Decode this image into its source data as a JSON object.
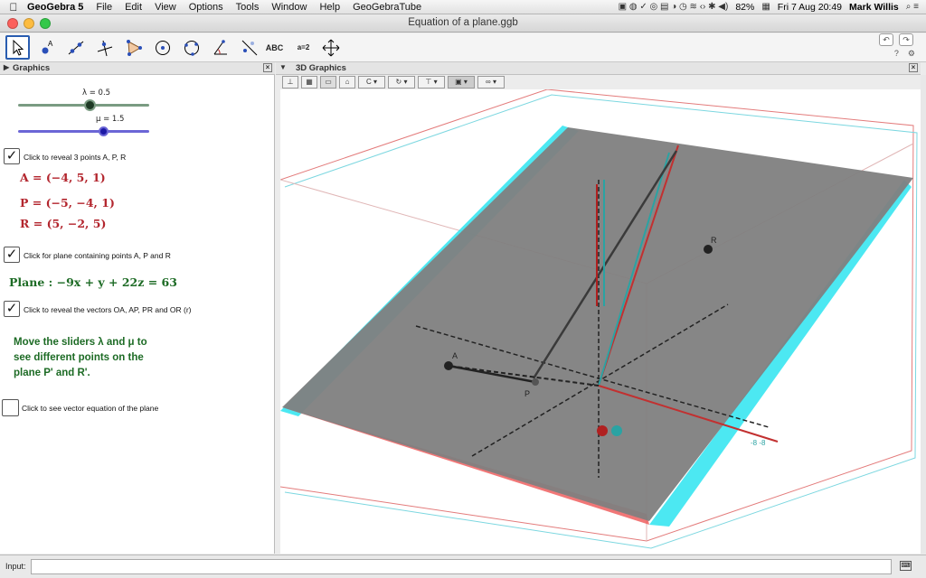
{
  "menubar": {
    "app_name": "GeoGebra 5",
    "items": [
      "File",
      "Edit",
      "View",
      "Options",
      "Tools",
      "Window",
      "Help",
      "GeoGebraTube"
    ],
    "battery": "82%",
    "datetime": "Fri 7 Aug  20:49",
    "user": "Mark Willis"
  },
  "window": {
    "title": "Equation of a plane.ggb",
    "lights": [
      "#fc605c",
      "#fdbc40",
      "#34c84a"
    ]
  },
  "toolbar": {
    "tools": [
      "move-tool",
      "point-tool",
      "line-tool",
      "perpendicular-tool",
      "polygon-tool",
      "circle-tool",
      "circle-three-points-tool",
      "angle-tool",
      "reflect-tool",
      "text-tool",
      "slider-tool",
      "move-view-tool"
    ],
    "text_tool_label": "ABC",
    "slider_tool_label": "a=2"
  },
  "graphics": {
    "header": "Graphics",
    "lambda_label": "λ = 0.5",
    "mu_label": "μ = 1.5",
    "lambda_color": "#7a9b82",
    "mu_color": "#6b66d6",
    "lambda_value": 0.5,
    "mu_value": 1.5,
    "check1_label": "Click to reveal 3 points A, P, R",
    "point_a": "A = (−4, 5, 1)",
    "point_p": "P = (−5, −4, 1)",
    "point_r": "R = (5, −2, 5)",
    "check2_label": "Click for plane containing points A, P and R",
    "plane_eq": "Plane :  −9x + y + 22z = 63",
    "check3_label": "Click to reveal the vectors OA, AP, PR and OR (r)",
    "note_lines": [
      "Move the sliders λ and μ to",
      "see different points on the",
      "plane P' and R'."
    ],
    "check4_label": "Click to see vector equation of the plane",
    "check_glyph": "✓"
  },
  "graphics3d": {
    "header": "3D Graphics",
    "label_r": "R",
    "label_a": "A",
    "label_p": "P",
    "label_x": "-8 -8"
  },
  "input_bar": {
    "label": "Input:",
    "value": ""
  }
}
